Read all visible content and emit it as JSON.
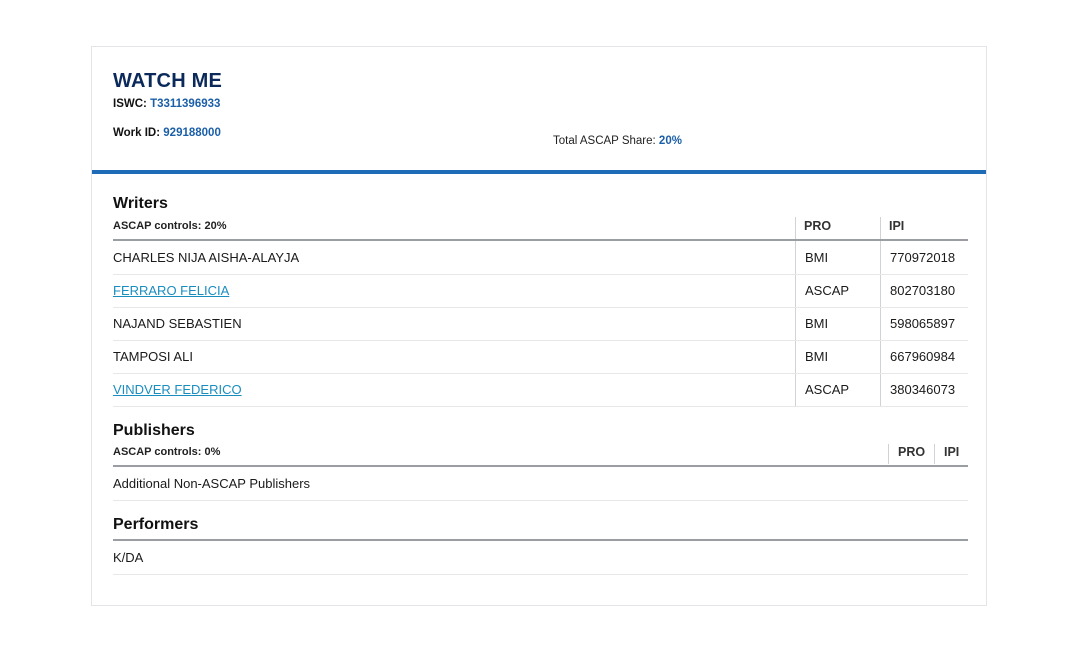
{
  "work": {
    "title": "WATCH ME",
    "iswc_label": "ISWC:",
    "iswc_value": "T3311396933",
    "work_id_label": "Work ID:",
    "work_id_value": "929188000",
    "total_share_label": "Total ASCAP Share:",
    "total_share_value": "20%"
  },
  "writers": {
    "heading": "Writers",
    "controls": "ASCAP controls: 20%",
    "col_pro": "PRO",
    "col_ipi": "IPI",
    "rows": [
      {
        "name": "CHARLES NIJA AISHA-ALAYJA",
        "pro": "BMI",
        "ipi": "770972018"
      },
      {
        "name": "FERRARO FELICIA",
        "pro": "ASCAP",
        "ipi": "802703180"
      },
      {
        "name": "NAJAND SEBASTIEN",
        "pro": "BMI",
        "ipi": "598065897"
      },
      {
        "name": "TAMPOSI ALI",
        "pro": "BMI",
        "ipi": "667960984"
      },
      {
        "name": "VINDVER FEDERICO",
        "pro": "ASCAP",
        "ipi": "380346073"
      }
    ]
  },
  "publishers": {
    "heading": "Publishers",
    "controls": "ASCAP controls: 0%",
    "col_pro": "PRO",
    "col_ipi": "IPI",
    "rows": [
      {
        "name": "Additional Non-ASCAP Publishers"
      }
    ]
  },
  "performers": {
    "heading": "Performers",
    "rows": [
      {
        "name": "K/DA"
      }
    ]
  },
  "colors": {
    "title": "#0b2a5b",
    "accent_bar": "#1e6cb7",
    "link": "#1a8dbf",
    "value_blue": "#1b5fa8"
  }
}
